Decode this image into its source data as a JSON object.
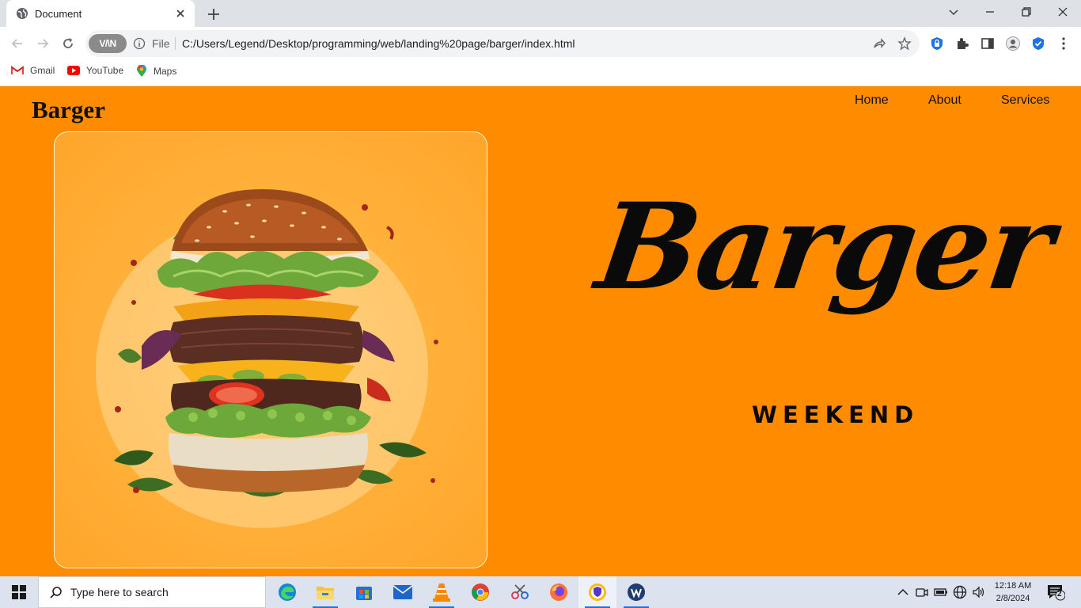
{
  "browser": {
    "tab_title": "Document",
    "url_scheme_label": "File",
    "url": "C:/Users/Legend/Desktop/programming/web/landing%20page/barger/index.html",
    "vpn_label": "V/\\N",
    "bookmarks": [
      {
        "label": "Gmail",
        "icon": "gmail-icon"
      },
      {
        "label": "YouTube",
        "icon": "youtube-icon"
      },
      {
        "label": "Maps",
        "icon": "maps-icon"
      }
    ]
  },
  "site": {
    "logo": "Barger",
    "nav": [
      "Home",
      "About",
      "Services"
    ],
    "hero_image_alt": "burger illustration",
    "hero_title": "Barger",
    "hero_subtitle": "WEEKEND"
  },
  "taskbar": {
    "search_placeholder": "Type here to search",
    "apps": [
      "edge",
      "file-explorer",
      "microsoft-store",
      "mail",
      "vlc",
      "chrome",
      "snipping-tool",
      "firefox",
      "browser-active",
      "wps"
    ],
    "time": "12:18 AM",
    "date": "2/8/2024",
    "notifications": "2"
  },
  "colors": {
    "page_bg": "#ff8c00",
    "text": "#0a0a0a"
  }
}
